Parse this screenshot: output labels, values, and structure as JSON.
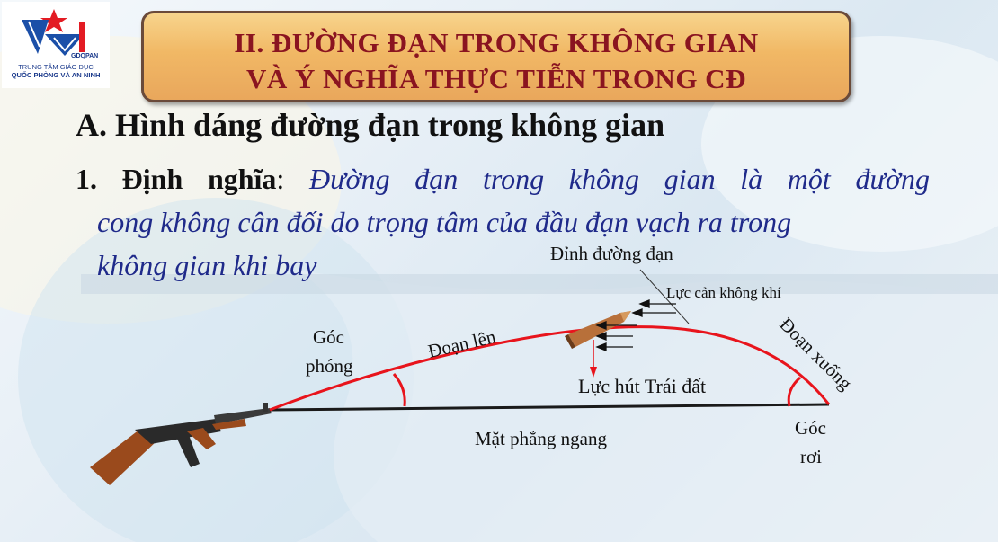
{
  "logo": {
    "abbr": "GDQPAN",
    "line1": "TRUNG TÂM GIÁO DỤC",
    "line2": "QUỐC PHÒNG VÀ AN NINH"
  },
  "title": {
    "line1": "II. ĐƯỜNG ĐẠN TRONG KHÔNG  GIAN",
    "line2": "VÀ Ý NGHĨA THỰC TIỄN TRONG CĐ"
  },
  "section": {
    "heading": "A. Hình dáng đường đạn trong không gian"
  },
  "definition": {
    "label": "1. Định nghĩa",
    "colon": ": ",
    "line1": "Đường đạn trong không gian là một đường",
    "line2": "cong không cân đối do trọng tâm của đầu đạn vạch ra trong",
    "line3": "không gian khi bay"
  },
  "diagram": {
    "apex": "Đỉnh đường đạn",
    "air_resistance": "Lực cản không khí",
    "launch_angle_1": "Góc",
    "launch_angle_2": "phóng",
    "ascending": "Đoạn lên",
    "descending": "Đoạn xuống",
    "gravity": "Lực hút Trái đất",
    "horizontal_plane": "Mặt phẳng ngang",
    "fall_angle_1": "Góc",
    "fall_angle_2": "rơi"
  },
  "colors": {
    "trajectory": "#e8141c",
    "title_text": "#8a1420",
    "definition_text": "#1f2a8a"
  }
}
